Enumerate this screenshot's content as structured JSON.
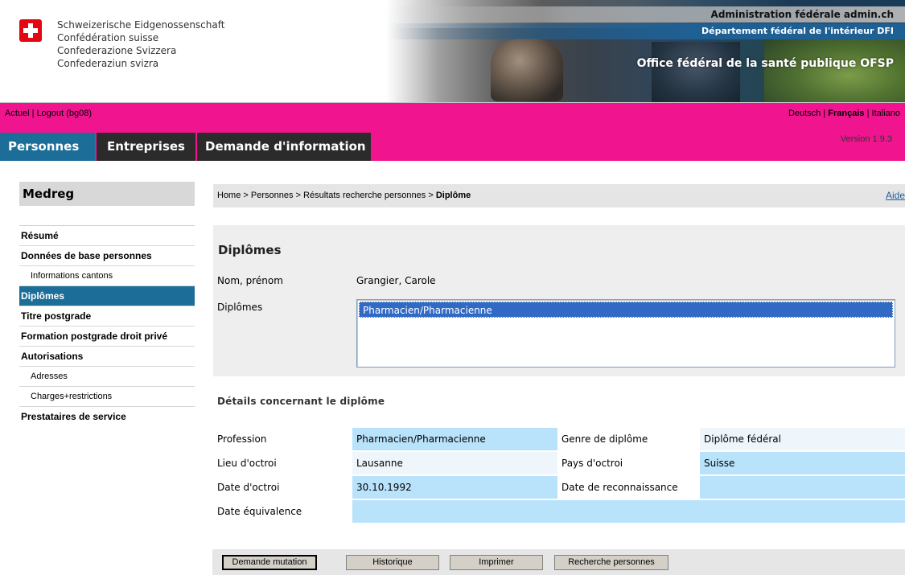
{
  "header": {
    "confederation_lines": [
      "Schweizerische Eidgenossenschaft",
      "Confédération suisse",
      "Confederazione Svizzera",
      "Confederaziun svizra"
    ],
    "admin": "Administration fédérale admin.ch",
    "department": "Département fédéral de l'intérieur DFI",
    "office": "Office fédéral de la santé publique OFSP"
  },
  "userbar": {
    "actuel": "Actuel",
    "logout": "Logout (bg08)",
    "languages": [
      {
        "label": "Deutsch",
        "active": false
      },
      {
        "label": "Français",
        "active": true
      },
      {
        "label": "Italiano",
        "active": false
      }
    ]
  },
  "nav": {
    "tabs": [
      "Personnes",
      "Entreprises",
      "Demande d'information"
    ],
    "active_tab": "Personnes",
    "version": "Version 1.9.3"
  },
  "sidebar": {
    "title": "Medreg",
    "items": [
      {
        "label": "Résumé",
        "sub": false,
        "active": false
      },
      {
        "label": "Données de base personnes",
        "sub": false,
        "active": false
      },
      {
        "label": "Informations cantons",
        "sub": true,
        "active": false
      },
      {
        "label": "Diplômes",
        "sub": false,
        "active": true
      },
      {
        "label": "Titre postgrade",
        "sub": false,
        "active": false
      },
      {
        "label": "Formation postgrade droit privé",
        "sub": false,
        "active": false
      },
      {
        "label": "Autorisations",
        "sub": false,
        "active": false
      },
      {
        "label": "Adresses",
        "sub": true,
        "active": false
      },
      {
        "label": "Charges+restrictions",
        "sub": true,
        "active": false
      },
      {
        "label": "Prestataires de service",
        "sub": false,
        "active": false
      }
    ]
  },
  "breadcrumb": {
    "home": "Home",
    "personnes": "Personnes",
    "results": "Résultats recherche personnes",
    "current": "Diplôme",
    "separator": " > ",
    "help": "Aide"
  },
  "diplomas": {
    "title": "Diplômes",
    "name_label": "Nom, prénom",
    "name_value": "Grangier, Carole",
    "list_label": "Diplômes",
    "list_options": [
      "Pharmacien/Pharmacienne"
    ],
    "selected_option": "Pharmacien/Pharmacienne"
  },
  "details": {
    "title": "Détails concernant le diplôme",
    "profession_label": "Profession",
    "profession_value": "Pharmacien/Pharmacienne",
    "genre_label": "Genre de diplôme",
    "genre_value": "Diplôme fédéral",
    "lieu_label": "Lieu d'octroi",
    "lieu_value": "Lausanne",
    "pays_label": "Pays d'octroi",
    "pays_value": "Suisse",
    "date_label": "Date d'octroi",
    "date_value": "30.10.1992",
    "reconnaissance_label": "Date de reconnaissance",
    "reconnaissance_value": "",
    "equivalence_label": "Date équivalence",
    "equivalence_value": ""
  },
  "buttons": {
    "mutation": "Demande mutation",
    "historique": "Historique",
    "imprimer": "Imprimer",
    "recherche": "Recherche personnes"
  },
  "colors": {
    "magenta": "#f0158f",
    "nav_active": "#1c6e98",
    "nav_dark": "#2b2b2b",
    "cell_blue": "#b9e2fb",
    "cell_pale": "#eef6fc",
    "swiss_red": "#e30613"
  }
}
